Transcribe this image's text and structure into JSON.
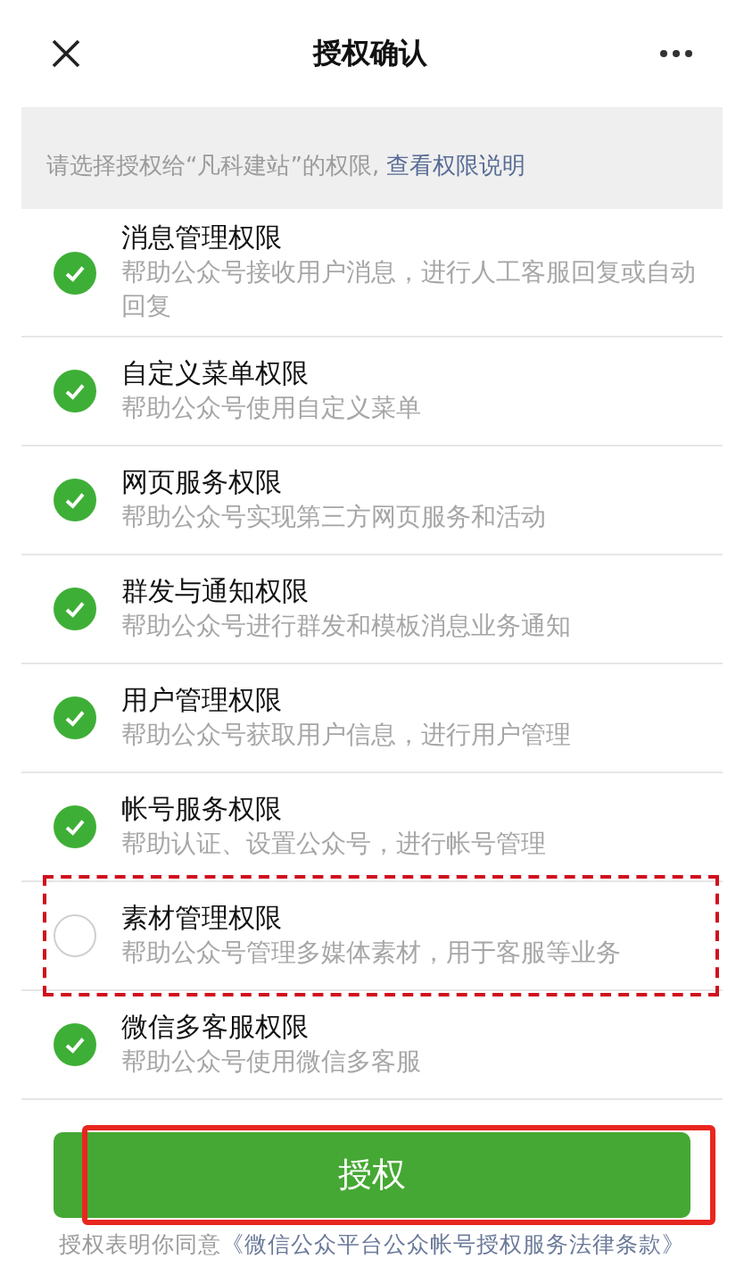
{
  "header": {
    "title": "授权确认"
  },
  "notice": {
    "text": "请选择授权给“凡科建站”的权限,",
    "link": "查看权限说明"
  },
  "permissions": [
    {
      "title": "消息管理权限",
      "description": "帮助公众号接收用户消息，进行人工客服回复或自动回复",
      "checked": true,
      "highlighted": false
    },
    {
      "title": "自定义菜单权限",
      "description": "帮助公众号使用自定义菜单",
      "checked": true,
      "highlighted": false
    },
    {
      "title": "网页服务权限",
      "description": "帮助公众号实现第三方网页服务和活动",
      "checked": true,
      "highlighted": false
    },
    {
      "title": "群发与通知权限",
      "description": "帮助公众号进行群发和模板消息业务通知",
      "checked": true,
      "highlighted": false
    },
    {
      "title": "用户管理权限",
      "description": "帮助公众号获取用户信息，进行用户管理",
      "checked": true,
      "highlighted": false
    },
    {
      "title": "帐号服务权限",
      "description": "帮助认证、设置公众号，进行帐号管理",
      "checked": true,
      "highlighted": false
    },
    {
      "title": "素材管理权限",
      "description": "帮助公众号管理多媒体素材，用于客服等业务",
      "checked": false,
      "highlighted": true
    },
    {
      "title": "微信多客服权限",
      "description": "帮助公众号使用微信多客服",
      "checked": true,
      "highlighted": false
    }
  ],
  "authorize_button": {
    "label": "授权",
    "highlighted": true
  },
  "footer": {
    "text": "授权表明你同意",
    "link": "《微信公众平台公众帐号授权服务法律条款》"
  }
}
